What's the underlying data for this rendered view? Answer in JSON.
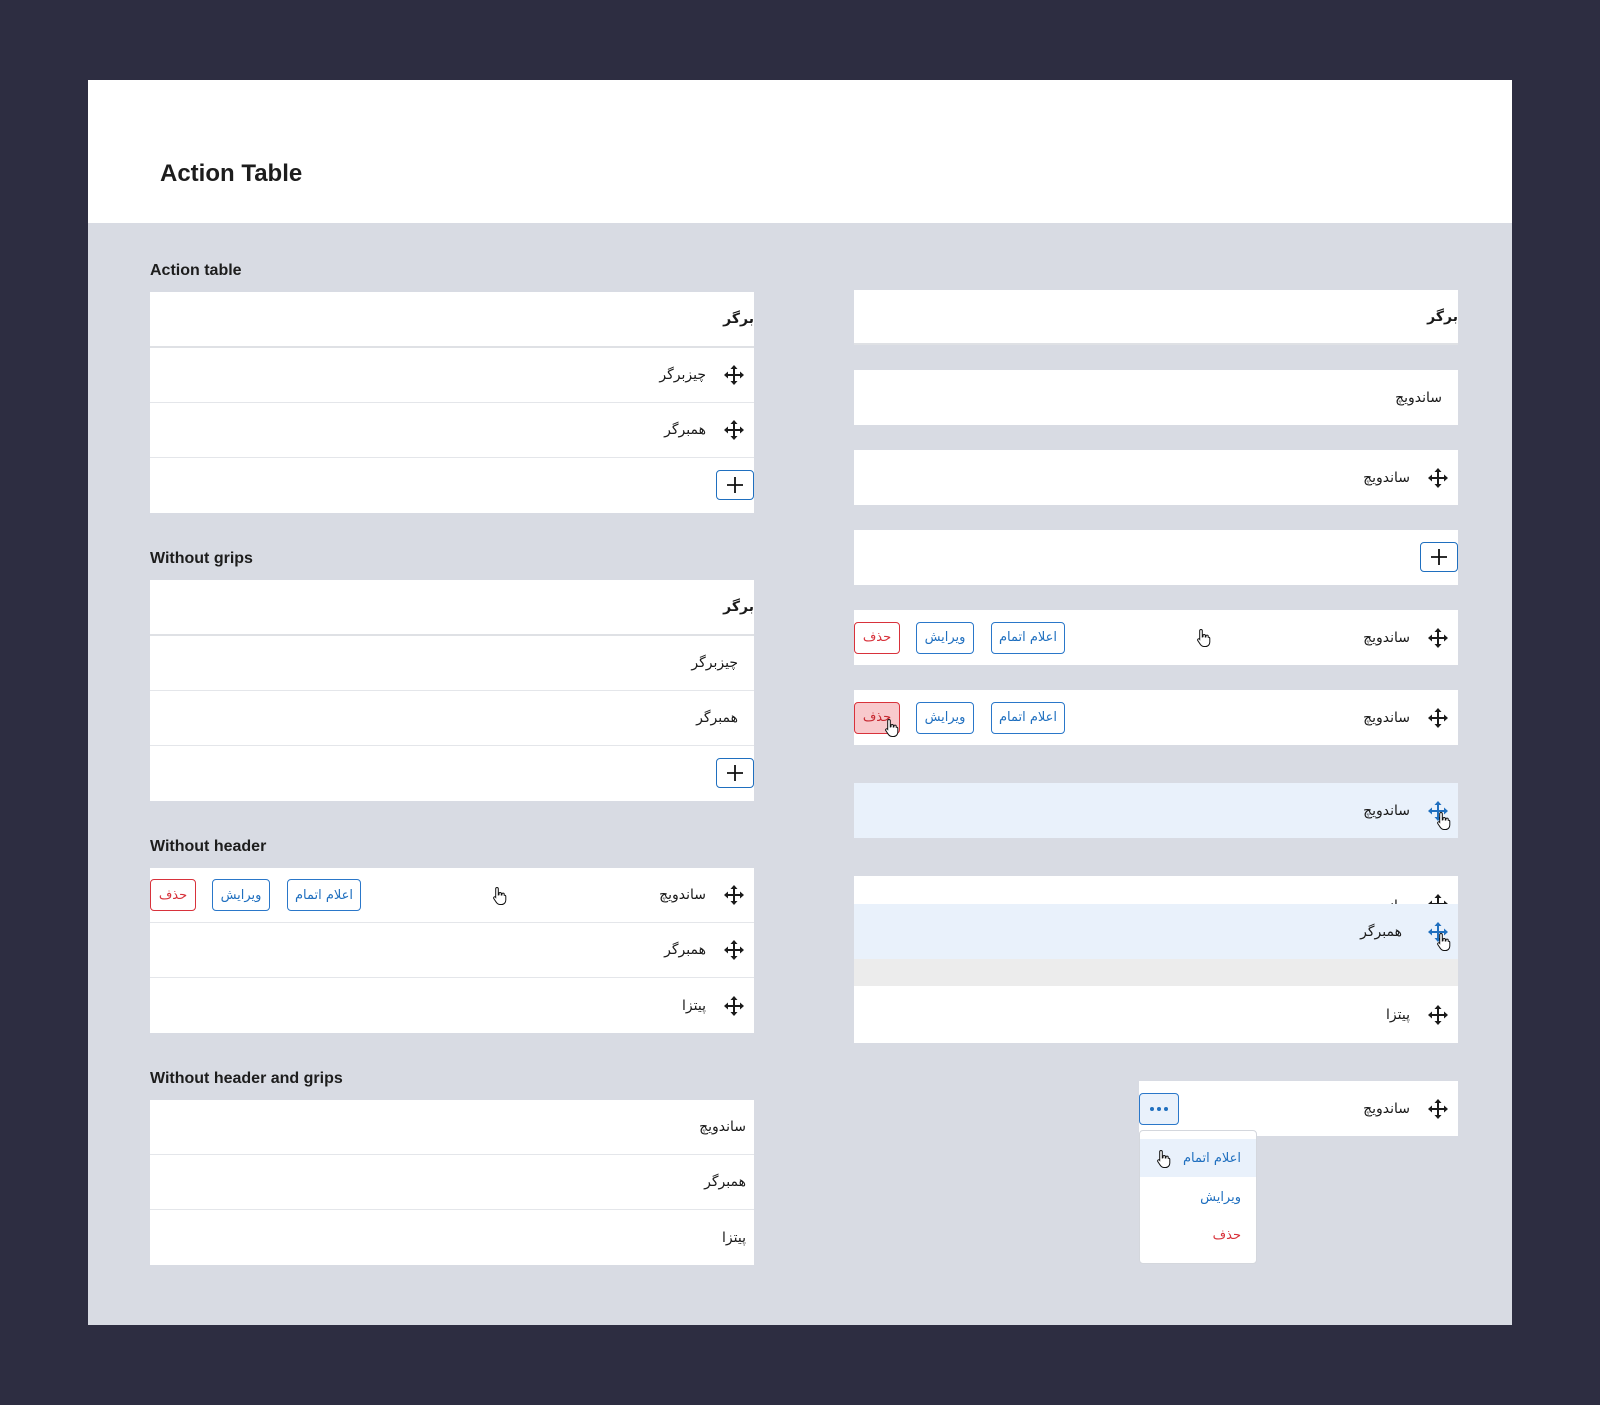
{
  "page_title": "Action Table",
  "colors": {
    "accent": "#1f6fbf",
    "danger": "#d8323b",
    "row_highlight": "#e9f1fb"
  },
  "sections": {
    "action_table": {
      "title": "Action table",
      "header": "برگر",
      "rows": [
        "چیزبرگر",
        "همبرگر"
      ]
    },
    "without_grips": {
      "title": "Without grips",
      "header": "برگر",
      "rows": [
        "چیزبرگر",
        "همبرگر"
      ]
    },
    "without_header": {
      "title": "Without header",
      "rows": [
        "ساندویچ",
        "همبرگر",
        "پیتزا"
      ],
      "actions": {
        "complete": "اعلام اتمام",
        "edit": "ویرایش",
        "delete": "حذف"
      }
    },
    "without_header_and_grips": {
      "title": "Without header and grips",
      "rows": [
        "ساندویچ",
        "همبرگر",
        "پیتزا"
      ]
    }
  },
  "states": {
    "header_row": "برگر",
    "plain_row": "ساندویچ",
    "grip_row": "ساندویچ",
    "hover_row": {
      "label": "ساندویچ",
      "complete": "اعلام اتمام",
      "edit": "ویرایش",
      "delete": "حذف"
    },
    "pressed_row": {
      "label": "ساندویچ",
      "complete": "اعلام اتمام",
      "edit": "ویرایش",
      "delete": "حذف"
    },
    "dragging_row": "ساندویچ",
    "drag_list": {
      "behind": "ساندویچ",
      "dragged": "همبرگر",
      "after": "پیتزا"
    },
    "overflow_row": "ساندویچ",
    "overflow_menu": [
      "اعلام اتمام",
      "ویرایش",
      "حذف"
    ]
  },
  "icons": {
    "grip": "move-arrows-icon",
    "add": "plus-icon",
    "more": "more-dots-icon",
    "cursor": "hand-pointer-icon"
  }
}
